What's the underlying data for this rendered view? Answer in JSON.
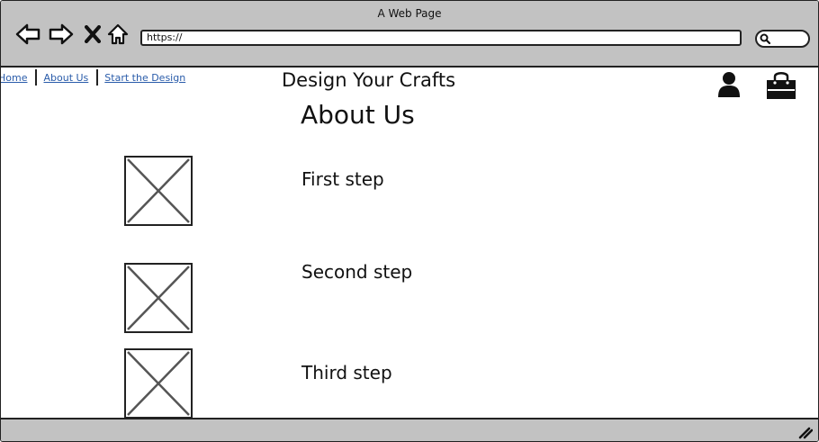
{
  "window": {
    "title": "A Web Page"
  },
  "browser": {
    "url": "https://"
  },
  "nav": {
    "links": [
      "Home",
      "About Us",
      "Start the Design"
    ]
  },
  "header": {
    "brand": "Design Your Crafts"
  },
  "main": {
    "heading": "About Us",
    "steps": [
      {
        "label": "First step",
        "image_icon": "image-placeholder-icon"
      },
      {
        "label": "Second step",
        "image_icon": "image-placeholder-icon"
      },
      {
        "label": "Third step",
        "image_icon": "image-placeholder-icon"
      }
    ]
  },
  "icons": [
    "back-arrow-icon",
    "forward-arrow-icon",
    "close-icon",
    "home-icon",
    "search-icon",
    "user-icon",
    "shopping-bag-icon",
    "resize-grip-icon"
  ],
  "colors": {
    "chrome": "#c2c2c2",
    "link": "#2a5caa",
    "ink": "#222222"
  }
}
